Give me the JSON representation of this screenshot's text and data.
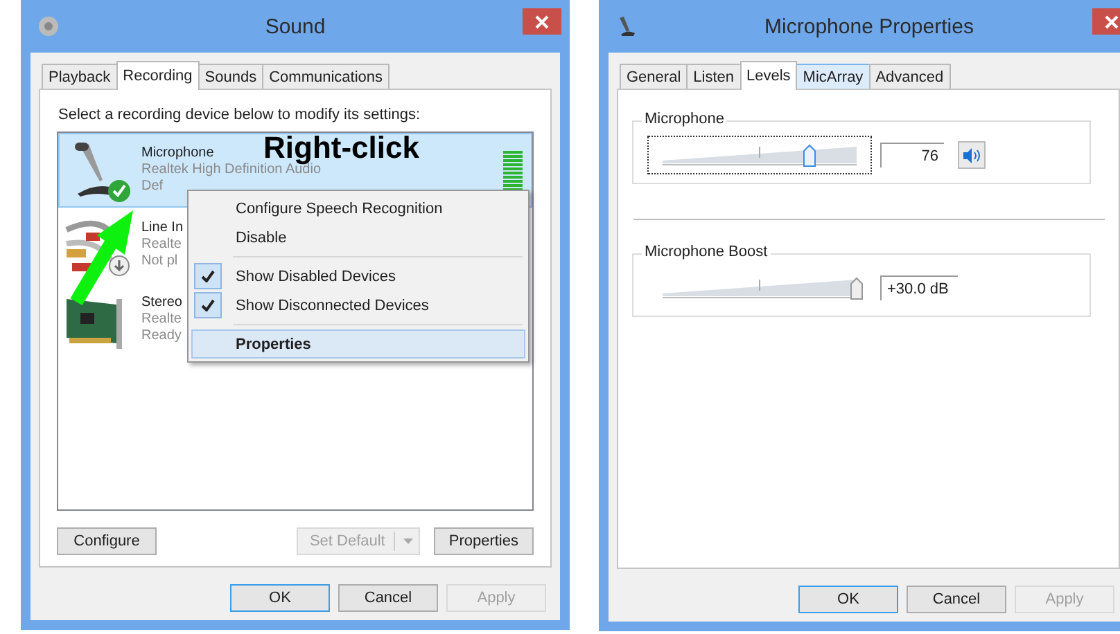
{
  "sound_window": {
    "title": "Sound",
    "tabs": [
      {
        "label": "Playback",
        "selected": false
      },
      {
        "label": "Recording",
        "selected": true
      },
      {
        "label": "Sounds",
        "selected": false
      },
      {
        "label": "Communications",
        "selected": false
      }
    ],
    "instruction": "Select a recording device below to modify its settings:",
    "devices": [
      {
        "kind": "microphone",
        "name": "Microphone",
        "description": "Realtek High Definition Audio",
        "status": "Def",
        "default_device": true,
        "unplugged": false,
        "selected": true,
        "level": 1
      },
      {
        "kind": "cables",
        "name": "Line In",
        "description": "Realte",
        "status": "Not pl",
        "default_device": false,
        "unplugged": true,
        "selected": false
      },
      {
        "kind": "card",
        "name": "Stereo",
        "description": "Realte",
        "status": "Ready",
        "default_device": false,
        "unplugged": false,
        "selected": false
      }
    ],
    "context_menu": [
      {
        "kind": "item",
        "label": "Configure Speech Recognition",
        "checked": false,
        "highlighted": false,
        "default": false
      },
      {
        "kind": "item",
        "label": "Disable",
        "checked": false,
        "highlighted": false,
        "default": false
      },
      {
        "kind": "separator"
      },
      {
        "kind": "item",
        "label": "Show Disabled Devices",
        "checked": true,
        "highlighted": false,
        "default": false
      },
      {
        "kind": "item",
        "label": "Show Disconnected Devices",
        "checked": true,
        "highlighted": false,
        "default": false
      },
      {
        "kind": "separator"
      },
      {
        "kind": "item",
        "label": "Properties",
        "checked": false,
        "highlighted": true,
        "default": true
      }
    ],
    "panel_buttons": [
      {
        "label": "Configure",
        "kind": "plain",
        "disabled": false
      },
      {
        "label": "Set Default",
        "kind": "split",
        "disabled": true
      },
      {
        "label": "Properties",
        "kind": "plain",
        "disabled": false
      }
    ],
    "dialog_buttons": [
      {
        "label": "OK",
        "disabled": false,
        "focused": true
      },
      {
        "label": "Cancel",
        "disabled": false,
        "focused": false
      },
      {
        "label": "Apply",
        "disabled": true,
        "focused": false
      }
    ]
  },
  "annotation": {
    "text": "Right-click"
  },
  "properties_window": {
    "title": "Microphone Properties",
    "tabs": [
      {
        "label": "General",
        "selected": false,
        "hovered": false
      },
      {
        "label": "Listen",
        "selected": false,
        "hovered": false
      },
      {
        "label": "Levels",
        "selected": true,
        "hovered": false
      },
      {
        "label": "MicArray",
        "selected": false,
        "hovered": true
      },
      {
        "label": "Advanced",
        "selected": false,
        "hovered": false
      }
    ],
    "groups": [
      {
        "title": "Microphone",
        "level": 0.76,
        "value": "76",
        "focused": true,
        "muted": false
      },
      {
        "title": "Microphone Boost",
        "level": 1,
        "value": "+30.0 dB",
        "focused": false
      }
    ],
    "dialog_buttons": [
      {
        "label": "OK",
        "disabled": false,
        "focused": true
      },
      {
        "label": "Cancel",
        "disabled": false,
        "focused": false
      },
      {
        "label": "Apply",
        "disabled": true,
        "focused": false
      }
    ]
  }
}
